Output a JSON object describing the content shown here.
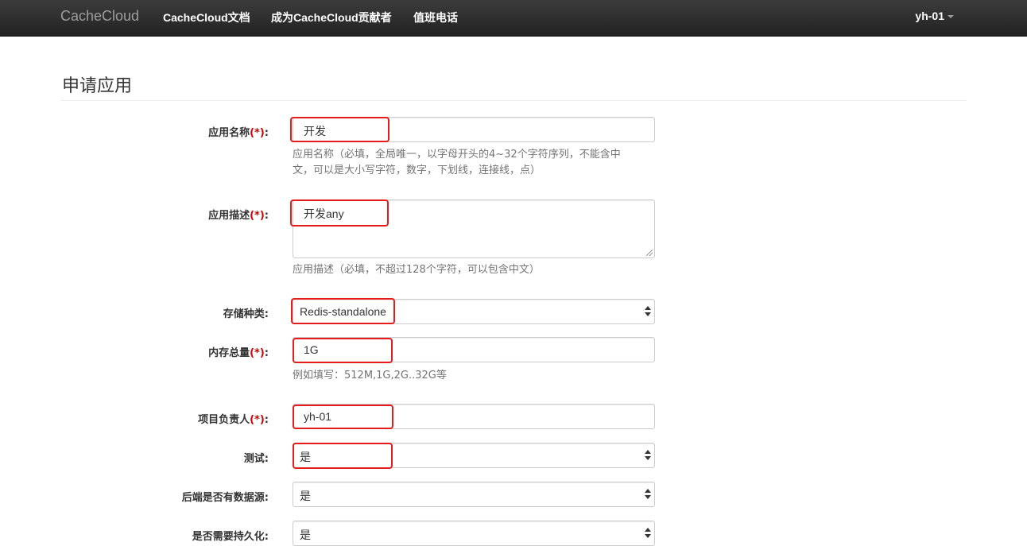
{
  "navbar": {
    "brand": "CacheCloud",
    "links": [
      "CacheCloud文档",
      "成为CacheCloud贡献者",
      "值班电话"
    ],
    "user": "yh-01"
  },
  "page_title": "申请应用",
  "form": {
    "app_name": {
      "label": "应用名称",
      "required": "(*)",
      "colon": ":",
      "value": "开发",
      "help": "应用名称（必填，全局唯一，以字母开头的4~32个字符序列，不能含中文，可以是大小写字符，数字，下划线，连接线，点）",
      "help_line1": "应用名称（必填，全局唯一，以字母开头的4~32个字符序列，不能含中",
      "help_line2": "文，可以是大小写字符，数字，下划线，连接线，点）"
    },
    "app_desc": {
      "label": "应用描述",
      "required": "(*)",
      "colon": ":",
      "value": "开发any",
      "help": "应用描述（必填，不超过128个字符，可以包含中文）"
    },
    "storage_type": {
      "label": "存储种类",
      "colon": ":",
      "value": "Redis-standalone"
    },
    "memory": {
      "label": "内存总量",
      "required": "(*)",
      "colon": ":",
      "value": "1G",
      "help": "例如填写：512M,1G,2G..32G等"
    },
    "owner": {
      "label": "项目负责人",
      "required": "(*)",
      "colon": ":",
      "value": "yh-01"
    },
    "test": {
      "label": "测试",
      "colon": ":",
      "value": "是"
    },
    "has_datasource": {
      "label": "后端是否有数据源",
      "colon": ":",
      "value": "是"
    },
    "need_persist": {
      "label": "是否需要持久化",
      "colon": ":",
      "value": "是"
    }
  },
  "colors": {
    "highlight": "#e51c1c",
    "required": "#d20000",
    "navbar": "#222222"
  }
}
